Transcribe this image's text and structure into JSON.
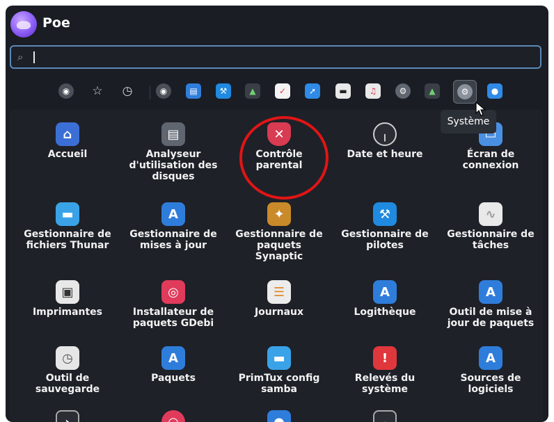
{
  "header": {
    "username": "Poe"
  },
  "search": {
    "value": "",
    "placeholder": ""
  },
  "categories": [
    {
      "icon": "favorites-app-icon"
    },
    {
      "icon": "star-icon"
    },
    {
      "icon": "recent-clock-icon"
    },
    {
      "icon": "all-apps-icon"
    },
    {
      "icon": "office-icon"
    },
    {
      "icon": "development-icon"
    },
    {
      "icon": "education-icon"
    },
    {
      "icon": "accessories-icon"
    },
    {
      "icon": "internet-icon"
    },
    {
      "icon": "games-icon"
    },
    {
      "icon": "multimedia-icon"
    },
    {
      "icon": "preferences-icon"
    },
    {
      "icon": "science-icon"
    },
    {
      "icon": "system-icon",
      "selected": true
    },
    {
      "icon": "other-icon"
    }
  ],
  "tooltip": "Système",
  "apps": [
    {
      "label": "Accueil",
      "icon": "home-icon",
      "color": "#3c6fd6"
    },
    {
      "label": "Analyseur\nd'utilisation des\ndisques",
      "icon": "disk-usage-icon",
      "color": "#5f6670"
    },
    {
      "label": "Contrôle\nparental",
      "icon": "parental-control-icon",
      "color": "#d83b52"
    },
    {
      "label": "Date et heure",
      "icon": "clock-icon",
      "color": "#2a2d33"
    },
    {
      "label": "Écran de\nconnexion",
      "icon": "login-screen-icon",
      "color": "#4a90e2"
    },
    {
      "label": "Gestionnaire de\nfichiers Thunar",
      "icon": "folder-icon",
      "color": "#3aa3e8"
    },
    {
      "label": "Gestionnaire de\nmises à jour",
      "icon": "update-manager-icon",
      "color": "#2f7ddb"
    },
    {
      "label": "Gestionnaire de\npaquets\nSynaptic",
      "icon": "synaptic-icon",
      "color": "#c98a2a"
    },
    {
      "label": "Gestionnaire de\npilotes",
      "icon": "drivers-icon",
      "color": "#1f8ae0"
    },
    {
      "label": "Gestionnaire de\ntâches",
      "icon": "task-manager-icon",
      "color": "#e9e9e9"
    },
    {
      "label": "Imprimantes",
      "icon": "printer-icon",
      "color": "#e8e8e8"
    },
    {
      "label": "Installateur de\npaquets GDebi",
      "icon": "gdebi-icon",
      "color": "#e03b5b"
    },
    {
      "label": "Journaux",
      "icon": "logs-icon",
      "color": "#ececec"
    },
    {
      "label": "Logithèque",
      "icon": "software-store-icon",
      "color": "#2f7ddb"
    },
    {
      "label": "Outil de mise à\njour de paquets",
      "icon": "package-updater-icon",
      "color": "#2f7ddb"
    },
    {
      "label": "Outil de\nsauvegarde",
      "icon": "backup-icon",
      "color": "#e6e6e6"
    },
    {
      "label": "Paquets",
      "icon": "packages-icon",
      "color": "#2f7ddb"
    },
    {
      "label": "PrimTux config\nsamba",
      "icon": "samba-folder-icon",
      "color": "#3aa3e8"
    },
    {
      "label": "Relevés du\nsystème",
      "icon": "system-report-icon",
      "color": "#e0373c"
    },
    {
      "label": "Sources de\nlogiciels",
      "icon": "software-sources-icon",
      "color": "#2f7ddb"
    },
    {
      "label": "",
      "icon": "terminal-icon",
      "color": "#2a2d33"
    },
    {
      "label": "",
      "icon": "help-icon",
      "color": "#e03b5b"
    },
    {
      "label": "",
      "icon": "user-icon",
      "color": "#2f7ddb"
    },
    {
      "label": "",
      "icon": "clock-small-icon",
      "color": "#2a2d33"
    }
  ]
}
